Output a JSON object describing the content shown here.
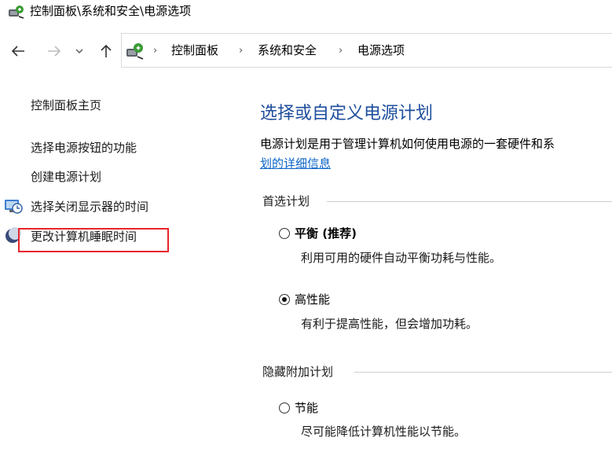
{
  "window": {
    "title": "控制面板\\系统和安全\\电源选项"
  },
  "nav": {
    "back_glyph": "←",
    "forward_glyph": "→",
    "recent_glyph": "⌄",
    "up_glyph": "↑"
  },
  "address": {
    "crumbs": [
      "控制面板",
      "系统和安全",
      "电源选项"
    ],
    "separator": "›"
  },
  "sidebar": {
    "items": [
      {
        "label": "控制面板主页"
      },
      {
        "label": "选择电源按钮的功能"
      },
      {
        "label": "创建电源计划"
      },
      {
        "label": "选择关闭显示器的时间"
      },
      {
        "label": "更改计算机睡眠时间"
      }
    ]
  },
  "main": {
    "title": "选择或自定义电源计划",
    "description": "电源计划是用于管理计算机如何使用电源的一套硬件和系",
    "description_link": "划的详细信息",
    "preferred_group": "首选计划",
    "hidden_group": "隐藏附加计划",
    "plans": [
      {
        "name": "平衡 (推荐)",
        "description": "利用可用的硬件自动平衡功耗与性能。",
        "selected": false
      },
      {
        "name": "高性能",
        "description": "有利于提高性能，但会增加功耗。",
        "selected": true
      },
      {
        "name": "节能",
        "description": "尽可能降低计算机性能以节能。",
        "selected": false
      }
    ]
  },
  "colors": {
    "title_blue": "#1e4e9c",
    "link_blue": "#0b64c8",
    "highlight_red": "#e8242b"
  }
}
